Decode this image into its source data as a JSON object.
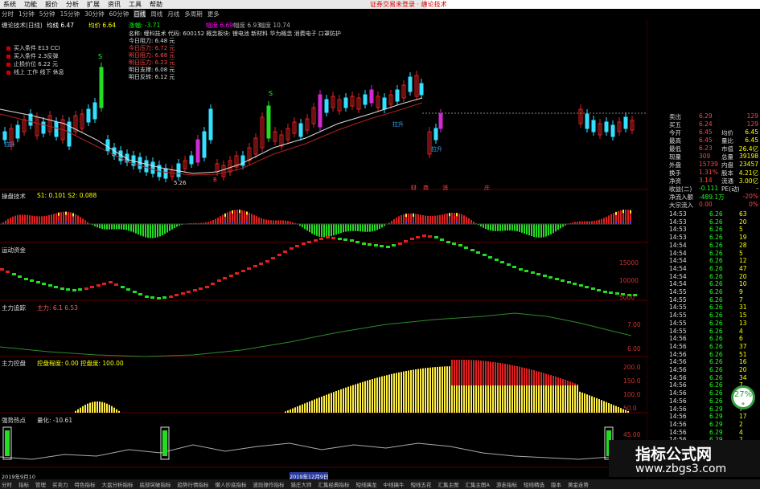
{
  "menu": {
    "items": [
      "系统",
      "功能",
      "报价",
      "分析",
      "扩展",
      "资讯",
      "工具",
      "帮助"
    ]
  },
  "broker_title": "证券交易未登录 · 缠论技术",
  "periods": {
    "items": [
      "分时",
      "1分钟",
      "5分钟",
      "15分钟",
      "30分钟",
      "60分钟",
      "日线",
      "周线",
      "月线",
      "多周期",
      "更多"
    ],
    "selected": "日线"
  },
  "main_panel": {
    "title": "缠论技术(日线)",
    "ma_label": "均线 6.47",
    "ma2_label": "均价 6.64",
    "extra_label": "涨幅: -3.71",
    "top_labels": [
      "幅度 6.69",
      "幅度 6.93",
      "幅度 10.74"
    ],
    "legend": [
      "买入条件 E13 CCI",
      "买入条件 2.3反弹",
      "止损价位 6.22 元",
      "线上 工作 线下 休息"
    ],
    "info_name": "名称: 缠科技术 代码: 600152 概念板块: 锂电池 新材料 华为概念 消费电子 口罩防护",
    "info_lines": [
      "今日阻力: 6.48 元",
      "今日压力: 6.72 元",
      "明日阻力: 6.68 元",
      "明日压力: 6.23 元",
      "明日支撑: 6.08 元",
      "明日反转: 6.12 元"
    ],
    "annotations": [
      "拉升",
      "拉升",
      "拉升",
      "5.26",
      "S",
      "S",
      "B"
    ],
    "signals": [
      "财",
      "商",
      "消",
      "庄"
    ]
  },
  "panel2": {
    "title": "操盘技术",
    "values": "S1: 0.101  S2: 0.088"
  },
  "panel3": {
    "title": "运动资金",
    "axis": [
      "15000",
      "10000",
      "5000"
    ]
  },
  "panel4": {
    "title": "主力追踪",
    "values": "主力: 6.1  6.53",
    "axis": [
      "7.00",
      "6.00"
    ]
  },
  "panel5": {
    "title": "主力控盘",
    "values": "控盘程度: 0.00  控盘度: 100.00",
    "axis": [
      "200.0",
      "150.0",
      "100.0",
      "50.0"
    ]
  },
  "panel6": {
    "title": "强势热点",
    "values": "量化: -10.61",
    "axis": [
      "45.00"
    ]
  },
  "date_bar": {
    "left": "2019年9月10",
    "mid": "2019年12月9日"
  },
  "quote": {
    "rows": [
      {
        "l": "卖出",
        "v1": "6.29",
        "v2": "129"
      },
      {
        "l": "买五",
        "v1": "6.24",
        "v2": "129"
      },
      {
        "l": "今开",
        "v1": "6.45",
        "l2": "均价",
        "v3": "6.45"
      },
      {
        "l": "最高",
        "v1": "6.45",
        "l2": "量比",
        "v3": "6.45"
      },
      {
        "l": "最低",
        "v1": "6.23",
        "l2": "市值",
        "v3": "26.4亿"
      },
      {
        "l": "现量",
        "v1": "309",
        "l2": "总量",
        "v3": "39198"
      },
      {
        "l": "外盘",
        "v1": "15739",
        "l2": "内盘",
        "v3": "23457"
      },
      {
        "l": "换手",
        "v1": "1.31%",
        "l2": "股本",
        "v3": "4.21亿"
      },
      {
        "l": "净资",
        "v1": "3.14",
        "l2": "流通",
        "v3": "3.00亿"
      },
      {
        "l": "收益(二)",
        "v1": "-0.111",
        "l2": "PE(动)",
        "v3": "-"
      },
      {
        "l": "净流入额",
        "v1": "-489.1万",
        "v2": "-20%"
      },
      {
        "l": "大宗流入",
        "v1": "0.00",
        "v2": "0%"
      }
    ],
    "ticks": [
      {
        "t": "14:53",
        "p": "6.26",
        "v": "63"
      },
      {
        "t": "14:53",
        "p": "6.26",
        "v": "20"
      },
      {
        "t": "14:53",
        "p": "6.26",
        "v": "5"
      },
      {
        "t": "14:53",
        "p": "6.26",
        "v": "19"
      },
      {
        "t": "14:54",
        "p": "6.26",
        "v": "28"
      },
      {
        "t": "14:54",
        "p": "6.26",
        "v": "5"
      },
      {
        "t": "14:54",
        "p": "6.26",
        "v": "12"
      },
      {
        "t": "14:54",
        "p": "6.26",
        "v": "47"
      },
      {
        "t": "14:54",
        "p": "6.26",
        "v": "20"
      },
      {
        "t": "14:54",
        "p": "6.26",
        "v": "10"
      },
      {
        "t": "14:55",
        "p": "6.26",
        "v": "9"
      },
      {
        "t": "14:55",
        "p": "6.26",
        "v": "7"
      },
      {
        "t": "14:55",
        "p": "6.26",
        "v": "31"
      },
      {
        "t": "14:55",
        "p": "6.26",
        "v": "15"
      },
      {
        "t": "14:55",
        "p": "6.26",
        "v": "13"
      },
      {
        "t": "14:55",
        "p": "6.26",
        "v": "4"
      },
      {
        "t": "14:56",
        "p": "6.26",
        "v": "6"
      },
      {
        "t": "14:56",
        "p": "6.26",
        "v": "37"
      },
      {
        "t": "14:56",
        "p": "6.26",
        "v": "51"
      },
      {
        "t": "14:56",
        "p": "6.26",
        "v": "16"
      },
      {
        "t": "14:56",
        "p": "6.26",
        "v": "20"
      },
      {
        "t": "14:56",
        "p": "6.26",
        "v": "34"
      },
      {
        "t": "14:56",
        "p": "6.26",
        "v": "7"
      },
      {
        "t": "14:56",
        "p": "6.26",
        "v": "50"
      },
      {
        "t": "14:56",
        "p": "6.26",
        "v": "13"
      },
      {
        "t": "14:56",
        "p": "6.29",
        "v": "7"
      },
      {
        "t": "14:56",
        "p": "6.29",
        "v": "17"
      },
      {
        "t": "14:56",
        "p": "6.29",
        "v": "2"
      },
      {
        "t": "14:56",
        "p": "6.29",
        "v": "4"
      },
      {
        "t": "14:56",
        "p": "6.29",
        "v": "2"
      }
    ],
    "gauge": "27%"
  },
  "bottom_tabs": [
    "分时",
    "指标",
    "管理",
    "买卖力",
    "特色指标",
    "大盘分析指标",
    "底部突破指标",
    "趋势行情指标",
    "懒人抄底指标",
    "波段操作指标",
    "猎庄大师",
    "汇集经典指标",
    "短线擒龙",
    "中线擒牛",
    "短线五花",
    "汇集主图",
    "汇集主图A",
    "游走指标",
    "短线精选",
    "版本",
    "黄金走势"
  ],
  "watermark": {
    "title": "指标公式网",
    "url": "www.zbgs3.com"
  },
  "colors": {
    "up": "#e02020",
    "down": "#33e0ff",
    "green": "#22dd22",
    "yellow": "#ffee44",
    "magenta": "#d02ad0"
  }
}
